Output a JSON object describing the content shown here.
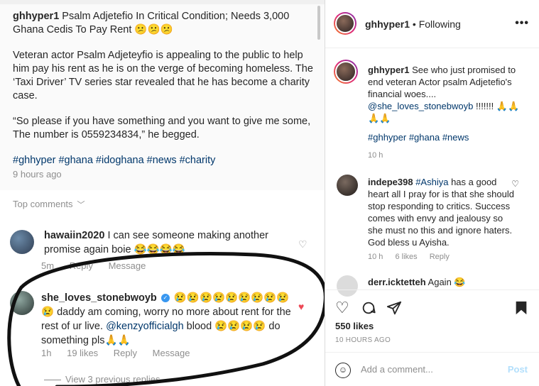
{
  "left": {
    "caption": {
      "title_user": "ghhyper1",
      "title_rest": " Psalm Adjetefio In Critical Condition; Needs 3,000 Ghana Cedis To Pay Rent 😕😕😕",
      "para1": "Veteran actor Psalm Adjeteyfio is appealing to the public to help him pay his rent as he is on the verge of becoming homeless. The ‘Taxi Driver’ TV series star revealed that he has become a charity case.",
      "para2": "“So please if you have something and you want to give me some, The number is 0559234834,” he begged.",
      "tags": "#ghhyper #ghana #idoghana #news #charity",
      "time": "9 hours ago"
    },
    "top_comments_label": "Top comments",
    "comment1": {
      "user": "hawaiin2020",
      "text": " I can see someone making another promise again boie 😂😂😂😂",
      "time": "5m",
      "reply": "Reply",
      "message": "Message"
    },
    "comment2": {
      "user": "she_loves_stonebwoyb",
      "text_a": "😢😢😢😢😢😢😢😢😢😢 daddy am coming, worry no more about rent for the rest of ur live. ",
      "mention": "@kenzyofficialgh",
      "text_b": " blood 😢😢😢😢 do something pls🙏🙏",
      "time": "1h",
      "likes": "19 likes",
      "reply": "Reply",
      "message": "Message"
    },
    "view_replies": "View 3 previous replies"
  },
  "right": {
    "header": {
      "user": "ghhyper1",
      "separator": " • ",
      "following": "Following",
      "more": "•••"
    },
    "caption": {
      "user": "ghhyper1",
      "text": " See who just promised to end veteran Actor psalm Adjetefio's financial woes.... ",
      "mention": "@she_loves_stonebwoyb",
      "text2": " !!!!!!! 🙏🙏🙏🙏",
      "tags": "#ghhyper #ghana #news",
      "time": "10 h"
    },
    "comment1": {
      "user": "indepe398",
      "mention": " #Ashiya",
      "text": " has a good heart all I pray for is that she should stop responding to critics. Success comes with envy and jealousy so she must no this and ignore haters. God bless u Ayisha.",
      "time": "10 h",
      "likes": "6 likes",
      "reply": "Reply"
    },
    "comment2": {
      "user": "derr.icktetteh",
      "text": " Again 😂"
    },
    "likes": "550 likes",
    "date": "10 HOURS AGO",
    "add_comment_placeholder": "Add a comment...",
    "post_label": "Post",
    "icons": [
      "heart-icon",
      "comment-icon",
      "share-icon",
      "bookmark-icon",
      "emoji-icon"
    ]
  }
}
